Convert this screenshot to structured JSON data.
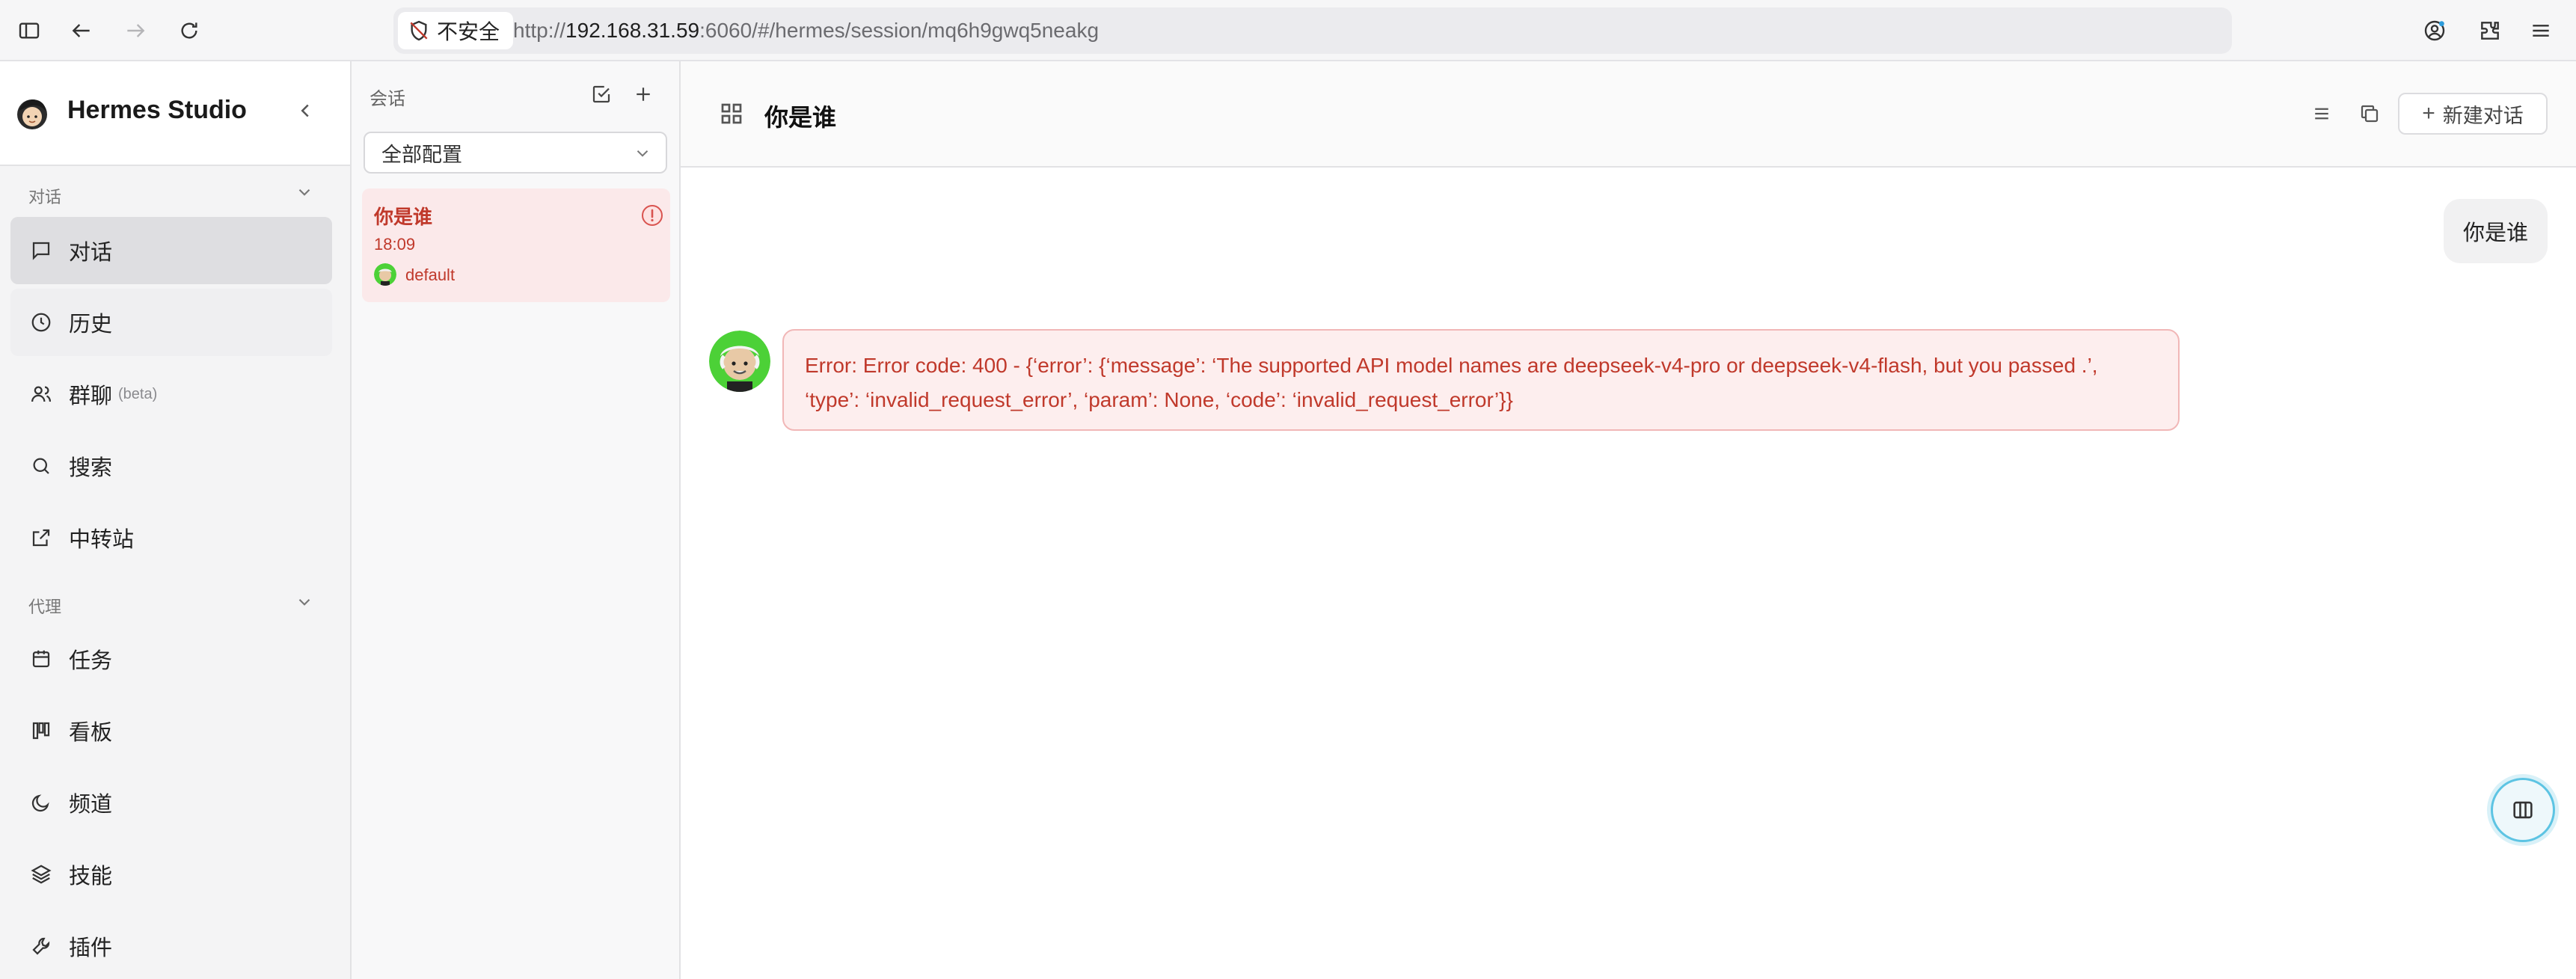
{
  "browser": {
    "security_label": "不安全",
    "url_prefix": "http://",
    "url_host": "192.168.31.59",
    "url_rest": ":6060/#/hermes/session/mq6h9gwq5neakg"
  },
  "sidebar": {
    "brand": "Hermes Studio",
    "section_chat": "对话",
    "section_agent": "代理",
    "items": [
      {
        "label": "对话",
        "icon": "message-square-icon",
        "active": true
      },
      {
        "label": "历史",
        "icon": "clock-icon"
      },
      {
        "label": "群聊",
        "beta": "(beta)",
        "icon": "users-icon"
      },
      {
        "label": "搜索",
        "icon": "search-icon"
      },
      {
        "label": "中转站",
        "icon": "external-link-icon"
      },
      {
        "label": "任务",
        "icon": "calendar-icon"
      },
      {
        "label": "看板",
        "icon": "kanban-icon"
      },
      {
        "label": "频道",
        "icon": "moon-icon"
      },
      {
        "label": "技能",
        "icon": "layers-icon"
      },
      {
        "label": "插件",
        "icon": "wrench-icon"
      }
    ]
  },
  "sessions": {
    "title": "会话",
    "filter_value": "全部配置",
    "items": [
      {
        "title": "你是谁",
        "time": "18:09",
        "profile": "default",
        "status": "error"
      }
    ]
  },
  "chat": {
    "title": "你是谁",
    "new_chat_label": "新建对话",
    "new_chat_icon": "+",
    "user_message": "你是谁",
    "error_line1": "Error: Error code: 400 - {‘error’: {‘message’: ‘The supported API model names are deepseek-v4-pro or deepseek-v4-flash, but you passed .’,",
    "error_line2": "‘type’: ‘invalid_request_error’, ‘param’: None, ‘code’: ‘invalid_request_error’}}"
  },
  "colors": {
    "accent_error": "#c0392b",
    "error_bg": "#fdeeee",
    "active_nav": "#dedee1",
    "float_ring": "#5dc4e3"
  }
}
